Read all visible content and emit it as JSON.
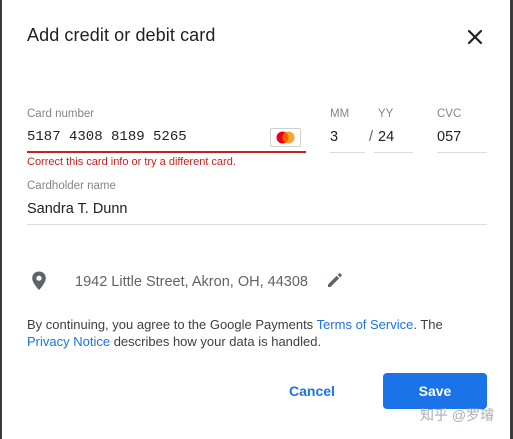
{
  "dialog": {
    "title": "Add credit or debit card",
    "close_icon": "close-icon"
  },
  "card_number": {
    "label": "Card number",
    "value": "5187 4308 8189 5265",
    "brand_icon": "mastercard-icon",
    "error": "Correct this card info or try a different card."
  },
  "expiry": {
    "month_label": "MM",
    "month_value": "3",
    "year_label": "YY",
    "year_value": "24",
    "separator": "/"
  },
  "cvc": {
    "label": "CVC",
    "value": "057"
  },
  "cardholder": {
    "label": "Cardholder name",
    "value": "Sandra T. Dunn"
  },
  "address": {
    "icon": "location-pin-icon",
    "value": "1942 Little Street, Akron, OH, 44308",
    "edit_icon": "edit-pencil-icon"
  },
  "terms": {
    "prefix": "By continuing, you agree to the Google Payments ",
    "tos_link": "Terms of Service",
    "middle": ". The",
    "privacy_link": "Privacy Notice",
    "suffix": " describes how your data is handled."
  },
  "actions": {
    "cancel_label": "Cancel",
    "save_label": "Save"
  },
  "watermark": "知乎 @罗璿",
  "colors": {
    "accent": "#1a73e8",
    "error": "#c5221f",
    "text": "#202124",
    "secondary_text": "#5f6368"
  }
}
